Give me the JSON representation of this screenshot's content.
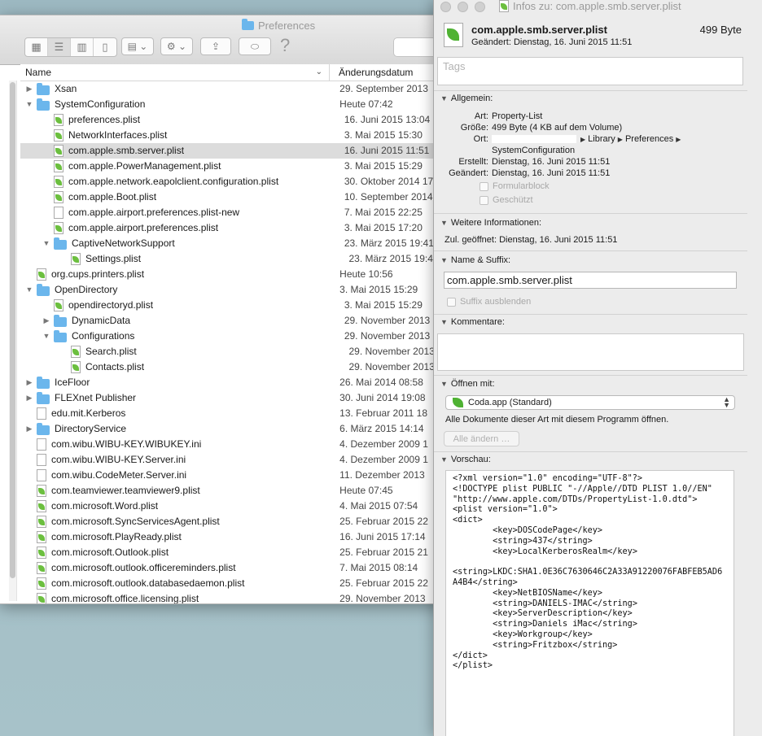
{
  "finder": {
    "title": "Preferences",
    "columns": {
      "name": "Name",
      "date": "Änderungsdatum"
    },
    "rows": [
      {
        "level": 0,
        "disclosure": "closed",
        "icon": "folder",
        "name": "Xsan",
        "date": "29. September 2013"
      },
      {
        "level": 0,
        "disclosure": "open",
        "icon": "folder",
        "name": "SystemConfiguration",
        "date": "Heute 07:42"
      },
      {
        "level": 1,
        "disclosure": "",
        "icon": "plist",
        "name": "preferences.plist",
        "date": "16. Juni 2015 13:04"
      },
      {
        "level": 1,
        "disclosure": "",
        "icon": "plist",
        "name": "NetworkInterfaces.plist",
        "date": "3. Mai 2015 15:30"
      },
      {
        "level": 1,
        "disclosure": "",
        "icon": "plist",
        "name": "com.apple.smb.server.plist",
        "date": "16. Juni 2015 11:51",
        "selected": true
      },
      {
        "level": 1,
        "disclosure": "",
        "icon": "plist",
        "name": "com.apple.PowerManagement.plist",
        "date": "3. Mai 2015 15:29"
      },
      {
        "level": 1,
        "disclosure": "",
        "icon": "plist",
        "name": "com.apple.network.eapolclient.configuration.plist",
        "date": "30. Oktober 2014 17"
      },
      {
        "level": 1,
        "disclosure": "",
        "icon": "plist",
        "name": "com.apple.Boot.plist",
        "date": "10. September 2014"
      },
      {
        "level": 1,
        "disclosure": "",
        "icon": "doc",
        "name": "com.apple.airport.preferences.plist-new",
        "date": "7. Mai 2015 22:25"
      },
      {
        "level": 1,
        "disclosure": "",
        "icon": "plist",
        "name": "com.apple.airport.preferences.plist",
        "date": "3. Mai 2015 17:20"
      },
      {
        "level": 1,
        "disclosure": "open",
        "icon": "folder",
        "name": "CaptiveNetworkSupport",
        "date": "23. März 2015 19:41"
      },
      {
        "level": 2,
        "disclosure": "",
        "icon": "plist",
        "name": "Settings.plist",
        "date": "23. März 2015 19:41"
      },
      {
        "level": 0,
        "disclosure": "",
        "icon": "plist",
        "name": "org.cups.printers.plist",
        "date": "Heute 10:56"
      },
      {
        "level": 0,
        "disclosure": "open",
        "icon": "folder",
        "name": "OpenDirectory",
        "date": "3. Mai 2015 15:29"
      },
      {
        "level": 1,
        "disclosure": "",
        "icon": "plist",
        "name": "opendirectoryd.plist",
        "date": "3. Mai 2015 15:29"
      },
      {
        "level": 1,
        "disclosure": "closed",
        "icon": "folder",
        "name": "DynamicData",
        "date": "29. November 2013"
      },
      {
        "level": 1,
        "disclosure": "open",
        "icon": "folder",
        "name": "Configurations",
        "date": "29. November 2013"
      },
      {
        "level": 2,
        "disclosure": "",
        "icon": "plist",
        "name": "Search.plist",
        "date": "29. November 2013"
      },
      {
        "level": 2,
        "disclosure": "",
        "icon": "plist",
        "name": "Contacts.plist",
        "date": "29. November 2013"
      },
      {
        "level": 0,
        "disclosure": "closed",
        "icon": "folder",
        "name": "IceFloor",
        "date": "26. Mai 2014 08:58"
      },
      {
        "level": 0,
        "disclosure": "closed",
        "icon": "folder",
        "name": "FLEXnet Publisher",
        "date": "30. Juni 2014 19:08"
      },
      {
        "level": 0,
        "disclosure": "",
        "icon": "doc",
        "name": "edu.mit.Kerberos",
        "date": "13. Februar 2011 18"
      },
      {
        "level": 0,
        "disclosure": "closed",
        "icon": "folder",
        "name": "DirectoryService",
        "date": "6. März 2015 14:14"
      },
      {
        "level": 0,
        "disclosure": "",
        "icon": "doc",
        "name": "com.wibu.WIBU-KEY.WIBUKEY.ini",
        "date": "4. Dezember 2009 1"
      },
      {
        "level": 0,
        "disclosure": "",
        "icon": "doc",
        "name": "com.wibu.WIBU-KEY.Server.ini",
        "date": "4. Dezember 2009 1"
      },
      {
        "level": 0,
        "disclosure": "",
        "icon": "doc",
        "name": "com.wibu.CodeMeter.Server.ini",
        "date": "11. Dezember 2013"
      },
      {
        "level": 0,
        "disclosure": "",
        "icon": "plist",
        "name": "com.teamviewer.teamviewer9.plist",
        "date": "Heute 07:45"
      },
      {
        "level": 0,
        "disclosure": "",
        "icon": "plist",
        "name": "com.microsoft.Word.plist",
        "date": "4. Mai 2015 07:54"
      },
      {
        "level": 0,
        "disclosure": "",
        "icon": "plist",
        "name": "com.microsoft.SyncServicesAgent.plist",
        "date": "25. Februar 2015 22"
      },
      {
        "level": 0,
        "disclosure": "",
        "icon": "plist",
        "name": "com.microsoft.PlayReady.plist",
        "date": "16. Juni 2015 17:14"
      },
      {
        "level": 0,
        "disclosure": "",
        "icon": "plist",
        "name": "com.microsoft.Outlook.plist",
        "date": "25. Februar 2015 21"
      },
      {
        "level": 0,
        "disclosure": "",
        "icon": "plist",
        "name": "com.microsoft.outlook.officereminders.plist",
        "date": "7. Mai 2015 08:14"
      },
      {
        "level": 0,
        "disclosure": "",
        "icon": "plist",
        "name": "com.microsoft.outlook.databasedaemon.plist",
        "date": "25. Februar 2015 22"
      },
      {
        "level": 0,
        "disclosure": "",
        "icon": "plist",
        "name": "com.microsoft.office.licensing.plist",
        "date": "29. November 2013"
      }
    ]
  },
  "info": {
    "window_title": "Infos zu: com.apple.smb.server.plist",
    "file_name": "com.apple.smb.server.plist",
    "file_size": "499 Byte",
    "modified_line": "Geändert: Dienstag, 16. Juni 2015 11:51",
    "tags_placeholder": "Tags",
    "general": {
      "header": "Allgemein:",
      "kind_label": "Art:",
      "kind": "Property-List",
      "size_label": "Größe:",
      "size": "499 Byte (4 KB auf dem Volume)",
      "where_label": "Ort:",
      "path_1": "Library",
      "path_2": "Preferences",
      "path_3": "SystemConfiguration",
      "created_label": "Erstellt:",
      "created": "Dienstag, 16. Juni 2015 11:51",
      "modified_label": "Geändert:",
      "modified": "Dienstag, 16. Juni 2015 11:51",
      "stationery": "Formularblock",
      "locked": "Geschützt"
    },
    "more_info": {
      "header": "Weitere Informationen:",
      "last_opened_label": "Zul. geöffnet:",
      "last_opened": "Dienstag, 16. Juni 2015 11:51"
    },
    "name_ext": {
      "header": "Name & Suffix:",
      "value": "com.apple.smb.server.plist",
      "hide_ext": "Suffix ausblenden"
    },
    "comments": {
      "header": "Kommentare:"
    },
    "open_with": {
      "header": "Öffnen mit:",
      "app": "Coda.app (Standard)",
      "note": "Alle Dokumente dieser Art mit diesem Programm öffnen.",
      "change_all": "Alle ändern …"
    },
    "preview": {
      "header": "Vorschau:",
      "text": "<?xml version=\"1.0\" encoding=\"UTF-8\"?>\n<!DOCTYPE plist PUBLIC \"-//Apple//DTD PLIST 1.0//EN\" \"http://www.apple.com/DTDs/PropertyList-1.0.dtd\">\n<plist version=\"1.0\">\n<dict>\n        <key>DOSCodePage</key>\n        <string>437</string>\n        <key>LocalKerberosRealm</key>\n\n<string>LKDC:SHA1.0E36C7630646C2A33A91220076FABFEB5AD6A4B4</string>\n        <key>NetBIOSName</key>\n        <string>DANIELS-IMAC</string>\n        <key>ServerDescription</key>\n        <string>Daniels iMac</string>\n        <key>Workgroup</key>\n        <string>Fritzbox</string>\n</dict>\n</plist>"
    }
  }
}
